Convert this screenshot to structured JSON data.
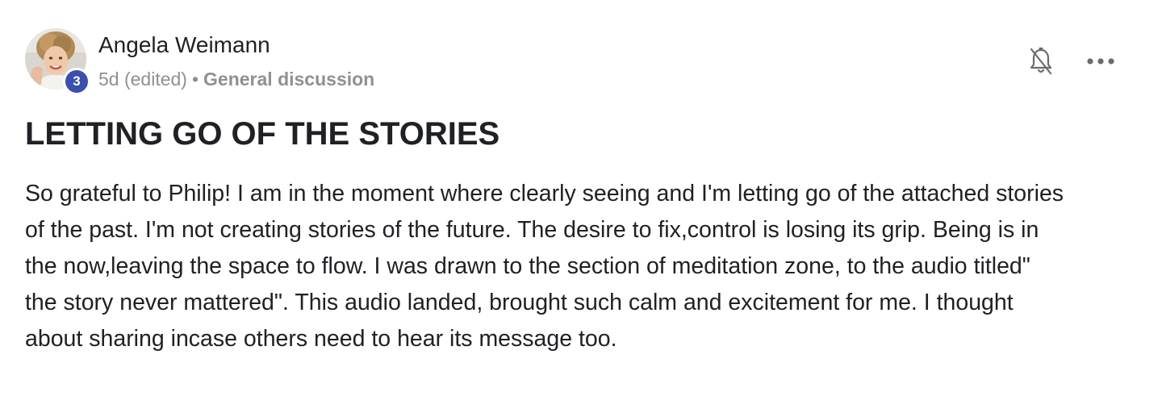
{
  "author": {
    "name": "Angela Weimann",
    "level": "3"
  },
  "meta": {
    "time": "5d (edited)",
    "separator": "•",
    "category": "General discussion"
  },
  "actions": {
    "bell_icon": "bell-off-icon",
    "more_icon": "more-horizontal-icon"
  },
  "post": {
    "title": "LETTING GO OF THE STORIES",
    "body_lines": [
      "So grateful to Philip! I am in the moment where clearly seeing and I'm letting go of the attached stories",
      "of the past. I'm not creating stories of the future. The desire to fix,control is losing its grip. Being is in",
      "the now,leaving the space to flow. I was drawn to the section of meditation zone, to the audio titled\"",
      "the story never mattered\". This audio landed, brought such calm and excitement for me. I thought",
      "about sharing incase others need to hear its message too."
    ]
  },
  "colors": {
    "badge": "#3b4fb0",
    "text": "#202124",
    "muted": "#909090"
  }
}
